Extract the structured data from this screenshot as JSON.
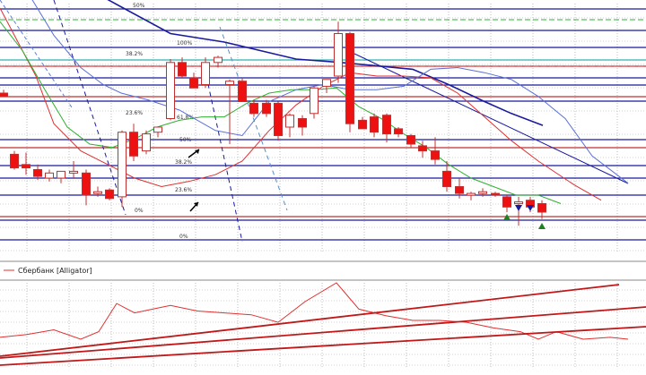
{
  "chart_data": [
    {
      "type": "candlestick",
      "title": "",
      "ylim": [
        0,
        100
      ],
      "grid": true,
      "candles": [
        {
          "x": 4,
          "o": 70,
          "h": 72,
          "l": 68,
          "c": 68,
          "dir": "down"
        },
        {
          "x": 16,
          "o": 34,
          "h": 36,
          "l": 25,
          "c": 26,
          "dir": "down"
        },
        {
          "x": 29,
          "o": 28,
          "h": 35,
          "l": 22,
          "c": 26,
          "dir": "down"
        },
        {
          "x": 42,
          "o": 25,
          "h": 28,
          "l": 19,
          "c": 21,
          "dir": "down"
        },
        {
          "x": 55,
          "o": 23,
          "h": 25,
          "l": 18,
          "c": 20,
          "dir": "up"
        },
        {
          "x": 68,
          "o": 20,
          "h": 24,
          "l": 17,
          "c": 24,
          "dir": "up"
        },
        {
          "x": 82,
          "o": 24,
          "h": 30,
          "l": 20,
          "c": 24,
          "dir": "up"
        },
        {
          "x": 96,
          "o": 23,
          "h": 25,
          "l": 4,
          "c": 10,
          "dir": "down"
        },
        {
          "x": 109,
          "o": 12,
          "h": 15,
          "l": 9,
          "c": 12,
          "dir": "up"
        },
        {
          "x": 122,
          "o": 13,
          "h": 14,
          "l": 7,
          "c": 8,
          "dir": "down"
        },
        {
          "x": 136,
          "o": 47,
          "h": 48,
          "l": 3,
          "c": 9,
          "dir": "up"
        },
        {
          "x": 149,
          "o": 47,
          "h": 52,
          "l": 30,
          "c": 33,
          "dir": "down"
        },
        {
          "x": 163,
          "o": 36,
          "h": 48,
          "l": 34,
          "c": 46,
          "dir": "up"
        },
        {
          "x": 176,
          "o": 47,
          "h": 50,
          "l": 44,
          "c": 50,
          "dir": "up"
        },
        {
          "x": 190,
          "o": 55,
          "h": 90,
          "l": 54,
          "c": 88,
          "dir": "up"
        },
        {
          "x": 203,
          "o": 88,
          "h": 91,
          "l": 79,
          "c": 80,
          "dir": "down"
        },
        {
          "x": 216,
          "o": 79,
          "h": 82,
          "l": 73,
          "c": 73,
          "dir": "down"
        },
        {
          "x": 229,
          "o": 75,
          "h": 91,
          "l": 73,
          "c": 88,
          "dir": "up"
        },
        {
          "x": 243,
          "o": 88,
          "h": 92,
          "l": 85,
          "c": 91,
          "dir": "up"
        },
        {
          "x": 256,
          "o": 77,
          "h": 78,
          "l": 40,
          "c": 75,
          "dir": "up"
        },
        {
          "x": 270,
          "o": 77,
          "h": 79,
          "l": 65,
          "c": 65,
          "dir": "down"
        },
        {
          "x": 283,
          "o": 64,
          "h": 66,
          "l": 56,
          "c": 58,
          "dir": "down"
        },
        {
          "x": 297,
          "o": 64,
          "h": 66,
          "l": 56,
          "c": 58,
          "dir": "down"
        },
        {
          "x": 310,
          "o": 64,
          "h": 65,
          "l": 42,
          "c": 45,
          "dir": "down"
        },
        {
          "x": 323,
          "o": 50,
          "h": 58,
          "l": 44,
          "c": 57,
          "dir": "up"
        },
        {
          "x": 337,
          "o": 55,
          "h": 57,
          "l": 45,
          "c": 50,
          "dir": "down"
        },
        {
          "x": 350,
          "o": 58,
          "h": 74,
          "l": 55,
          "c": 73,
          "dir": "up"
        },
        {
          "x": 364,
          "o": 74,
          "h": 78,
          "l": 70,
          "c": 78,
          "dir": "up"
        },
        {
          "x": 377,
          "o": 80,
          "h": 112,
          "l": 76,
          "c": 105,
          "dir": "up"
        },
        {
          "x": 390,
          "o": 105,
          "h": 106,
          "l": 47,
          "c": 52,
          "dir": "down"
        },
        {
          "x": 404,
          "o": 54,
          "h": 56,
          "l": 49,
          "c": 49,
          "dir": "down"
        },
        {
          "x": 417,
          "o": 56,
          "h": 58,
          "l": 44,
          "c": 47,
          "dir": "down"
        },
        {
          "x": 431,
          "o": 57,
          "h": 58,
          "l": 41,
          "c": 46,
          "dir": "down"
        },
        {
          "x": 444,
          "o": 49,
          "h": 50,
          "l": 44,
          "c": 46,
          "dir": "down"
        },
        {
          "x": 458,
          "o": 45,
          "h": 46,
          "l": 38,
          "c": 40,
          "dir": "down"
        },
        {
          "x": 471,
          "o": 39,
          "h": 42,
          "l": 32,
          "c": 36,
          "dir": "down"
        },
        {
          "x": 485,
          "o": 36,
          "h": 44,
          "l": 28,
          "c": 31,
          "dir": "down"
        },
        {
          "x": 498,
          "o": 24,
          "h": 30,
          "l": 12,
          "c": 15,
          "dir": "down"
        },
        {
          "x": 512,
          "o": 15,
          "h": 20,
          "l": 8,
          "c": 11,
          "dir": "down"
        },
        {
          "x": 525,
          "o": 11,
          "h": 12,
          "l": 7,
          "c": 11,
          "dir": "up"
        },
        {
          "x": 538,
          "o": 11,
          "h": 14,
          "l": 9,
          "c": 12,
          "dir": "up"
        },
        {
          "x": 552,
          "o": 11,
          "h": 12,
          "l": 9,
          "c": 10,
          "dir": "down"
        },
        {
          "x": 565,
          "o": 9,
          "h": 10,
          "l": 0,
          "c": 3,
          "dir": "down"
        },
        {
          "x": 578,
          "o": 6,
          "h": 9,
          "l": -8,
          "c": 6,
          "dir": "up"
        },
        {
          "x": 591,
          "o": 7,
          "h": 9,
          "l": 0,
          "c": 3,
          "dir": "down"
        },
        {
          "x": 604,
          "o": 5,
          "h": 7,
          "l": -4,
          "c": 0,
          "dir": "down"
        }
      ],
      "series": [
        {
          "name": "jaw",
          "color": "#1a1a9e",
          "x": [
            0,
            60,
            120,
            190,
            250,
            330,
            380,
            420,
            460,
            500,
            540,
            570,
            605
          ],
          "values": [
            180,
            150,
            125,
            105,
            100,
            90,
            88,
            86,
            84,
            75,
            65,
            58,
            51
          ]
        },
        {
          "name": "teeth",
          "color": "#e03030",
          "x": [
            0,
            20,
            40,
            60,
            90,
            120,
            150,
            180,
            210,
            240,
            270,
            300,
            330,
            360,
            390,
            420,
            450,
            480,
            510,
            540,
            570,
            600,
            640,
            670
          ],
          "values": [
            120,
            100,
            80,
            52,
            36,
            28,
            20,
            15,
            18,
            22,
            30,
            48,
            63,
            74,
            82,
            80,
            80,
            79,
            70,
            56,
            42,
            30,
            16,
            7
          ]
        },
        {
          "name": "lips",
          "color": "#30b030",
          "x": [
            0,
            25,
            50,
            75,
            100,
            125,
            150,
            175,
            200,
            225,
            250,
            275,
            300,
            325,
            350,
            375,
            400,
            425,
            450,
            475,
            500,
            525,
            550,
            575,
            600,
            625
          ],
          "values": [
            112,
            95,
            72,
            50,
            40,
            38,
            43,
            50,
            54,
            56,
            56,
            64,
            70,
            72,
            72,
            73,
            62,
            55,
            46,
            38,
            28,
            20,
            15,
            10,
            10,
            5
          ]
        },
        {
          "name": "blue-line",
          "color": "#5a70d8",
          "x": [
            0,
            30,
            60,
            90,
            115,
            135,
            165,
            200,
            240,
            270,
            300,
            330,
            360,
            390,
            420,
            450,
            480,
            510,
            540,
            570,
            600,
            630,
            660,
            700
          ],
          "values": [
            145,
            130,
            104,
            85,
            75,
            70,
            66,
            60,
            48,
            45,
            65,
            72,
            75,
            72,
            72,
            74,
            84,
            85,
            82,
            78,
            68,
            55,
            33,
            17
          ]
        }
      ],
      "levels": [
        {
          "label": "50%",
          "kind": "fib",
          "value": 148
        },
        {
          "label": "38.2%",
          "kind": "fib",
          "value": 128
        },
        {
          "label": "23.6%",
          "kind": "fib",
          "value": 65
        },
        {
          "label": "0%",
          "kind": "fib",
          "value": 0
        },
        {
          "label": "100%",
          "kind": "fib",
          "value": 110
        },
        {
          "label": "61.8%",
          "kind": "fib",
          "value": 59
        },
        {
          "label": "50%",
          "kind": "fib",
          "value": 49
        },
        {
          "label": "38.2%",
          "kind": "fib",
          "value": 36
        },
        {
          "label": "23.6%",
          "kind": "fib",
          "value": 21
        },
        {
          "label": "0%",
          "kind": "fib",
          "value": -14
        }
      ]
    },
    {
      "type": "line",
      "legend": "Сбербанк [Alligator]",
      "title": "",
      "grid": true,
      "series": [
        {
          "name": "",
          "color": "#e03030",
          "x": [
            0,
            30,
            60,
            90,
            110,
            130,
            150,
            170,
            190,
            220,
            250,
            280,
            310,
            340,
            375,
            400,
            430,
            460,
            490,
            520,
            550,
            580,
            600,
            620,
            650,
            680,
            700
          ],
          "values": [
            22,
            25,
            30,
            20,
            28,
            58,
            48,
            52,
            56,
            50,
            48,
            46,
            38,
            60,
            80,
            52,
            45,
            40,
            40,
            38,
            32,
            28,
            20,
            28,
            20,
            22,
            20
          ]
        }
      ]
    }
  ]
}
